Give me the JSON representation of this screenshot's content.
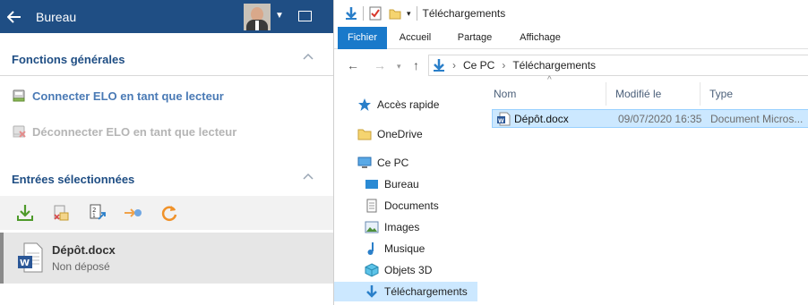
{
  "elo": {
    "header": {
      "title": "Bureau"
    },
    "sections": {
      "general": {
        "title": "Fonctions générales",
        "actions": [
          {
            "label": "Connecter ELO en tant que lecteur",
            "enabled": true
          },
          {
            "label": "Déconnecter ELO en tant que lecteur",
            "enabled": false
          }
        ]
      },
      "selected": {
        "title": "Entrées sélectionnées"
      }
    },
    "entry": {
      "name": "Dépôt.docx",
      "status": "Non déposé"
    }
  },
  "explorer": {
    "title": "Téléchargements",
    "ribbon_tabs": [
      "Fichier",
      "Accueil",
      "Partage",
      "Affichage"
    ],
    "breadcrumb": [
      "Ce PC",
      "Téléchargements"
    ],
    "nav": {
      "quick_access": "Accès rapide",
      "onedrive": "OneDrive",
      "this_pc": "Ce PC",
      "children": [
        "Bureau",
        "Documents",
        "Images",
        "Musique",
        "Objets 3D",
        "Téléchargements"
      ]
    },
    "columns": [
      "Nom",
      "Modifié le",
      "Type"
    ],
    "files": [
      {
        "name": "Dépôt.docx",
        "modified": "09/07/2020 16:35",
        "type": "Document Micros..."
      }
    ]
  },
  "colors": {
    "elo_header": "#1f4e84",
    "elo_link": "#4a7ab5",
    "ribbon_file": "#1979ca",
    "selection": "#cce8ff"
  }
}
